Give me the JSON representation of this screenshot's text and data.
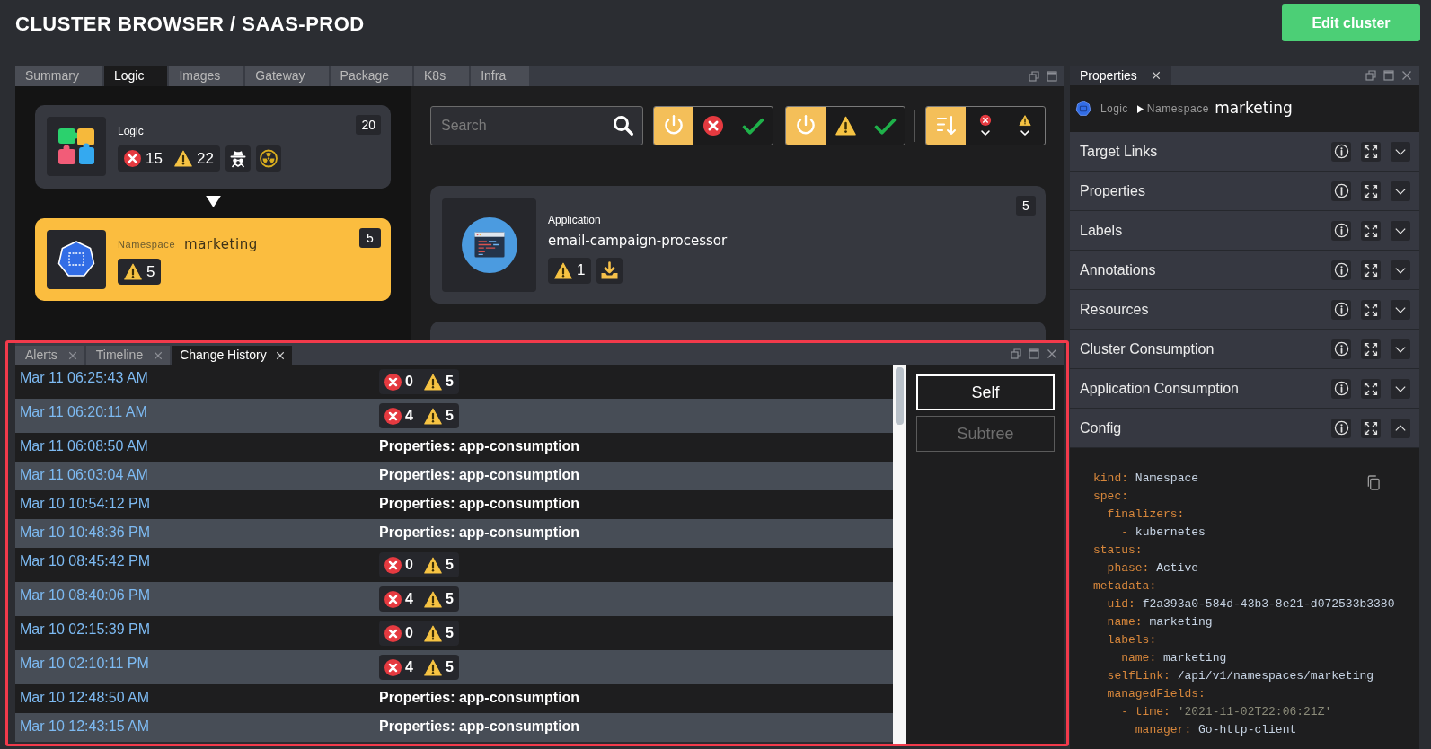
{
  "header": {
    "title": "CLUSTER BROWSER / SAAS-PROD",
    "button": "Edit cluster"
  },
  "main_panel": {
    "tabs": [
      {
        "label": "Summary",
        "selected": false
      },
      {
        "label": "Logic",
        "selected": true
      },
      {
        "label": "Images",
        "selected": false
      },
      {
        "label": "Gateway",
        "selected": false
      },
      {
        "label": "Package",
        "selected": false
      },
      {
        "label": "K8s",
        "selected": false
      },
      {
        "label": "Infra",
        "selected": false
      }
    ],
    "graph": [
      {
        "kind": "logic",
        "label": "Logic",
        "count": "20",
        "errors": "15",
        "warnings": "22",
        "flags": [
          {
            "kind": "spy"
          },
          {
            "kind": "radiation"
          }
        ],
        "selected": false
      },
      {
        "kind": "namespace",
        "label": "Namespace",
        "name": "marketing",
        "count": "5",
        "warnings": "5",
        "selected": true
      }
    ],
    "search": {
      "placeholder": "Search"
    },
    "filter_groups": [
      {
        "buttons": [
          {
            "kind": "power",
            "on": true
          },
          {
            "kind": "errors",
            "on": false
          },
          {
            "kind": "ok",
            "on": false
          }
        ]
      },
      {
        "buttons": [
          {
            "kind": "power",
            "on": true
          },
          {
            "kind": "warnings",
            "on": false
          },
          {
            "kind": "ok",
            "on": false
          }
        ]
      },
      {
        "buttons": [
          {
            "kind": "sort",
            "on": true
          },
          {
            "kind": "errors_sort",
            "on": false
          },
          {
            "kind": "warnings_sort",
            "on": false
          }
        ]
      }
    ],
    "items": [
      {
        "kind": "application",
        "label": "Application",
        "name": "email-campaign-processor",
        "count": "5",
        "warnings": "1",
        "flags": [
          {
            "kind": "download"
          }
        ]
      }
    ]
  },
  "bottom_panel": {
    "tabs": [
      {
        "label": "Alerts",
        "selected": false
      },
      {
        "label": "Timeline",
        "selected": false
      },
      {
        "label": "Change History",
        "selected": true
      }
    ],
    "rows": [
      {
        "time": "Mar 11 06:25:43 AM",
        "kind": "counts",
        "errors": "0",
        "warnings": "5"
      },
      {
        "time": "Mar 11 06:20:11 AM",
        "kind": "counts",
        "errors": "4",
        "warnings": "5"
      },
      {
        "time": "Mar 11 06:08:50 AM",
        "kind": "change",
        "text": "Properties: app-consumption"
      },
      {
        "time": "Mar 11 06:03:04 AM",
        "kind": "change",
        "text": "Properties: app-consumption"
      },
      {
        "time": "Mar 10 10:54:12 PM",
        "kind": "change",
        "text": "Properties: app-consumption"
      },
      {
        "time": "Mar 10 10:48:36 PM",
        "kind": "change",
        "text": "Properties: app-consumption"
      },
      {
        "time": "Mar 10 08:45:42 PM",
        "kind": "counts",
        "errors": "0",
        "warnings": "5"
      },
      {
        "time": "Mar 10 08:40:06 PM",
        "kind": "counts",
        "errors": "4",
        "warnings": "5"
      },
      {
        "time": "Mar 10 02:15:39 PM",
        "kind": "counts",
        "errors": "0",
        "warnings": "5"
      },
      {
        "time": "Mar 10 02:10:11 PM",
        "kind": "counts",
        "errors": "4",
        "warnings": "5"
      },
      {
        "time": "Mar 10 12:48:50 AM",
        "kind": "change",
        "text": "Properties: app-consumption"
      },
      {
        "time": "Mar 10 12:43:15 AM",
        "kind": "change",
        "text": "Properties: app-consumption"
      }
    ],
    "scope_buttons": [
      {
        "label": "Self",
        "selected": true
      },
      {
        "label": "Subtree",
        "selected": false
      }
    ]
  },
  "properties_panel": {
    "tab": "Properties",
    "breadcrumb": {
      "parent": "Logic",
      "type": "Namespace",
      "name": "marketing"
    },
    "sections": [
      {
        "title": "Target Links",
        "expanded": false
      },
      {
        "title": "Properties",
        "expanded": false
      },
      {
        "title": "Labels",
        "expanded": false
      },
      {
        "title": "Annotations",
        "expanded": false
      },
      {
        "title": "Resources",
        "expanded": false
      },
      {
        "title": "Cluster Consumption",
        "expanded": false
      },
      {
        "title": "Application Consumption",
        "expanded": false
      },
      {
        "title": "Config",
        "expanded": true,
        "content": [
          {
            "key": "kind:",
            "value": "Namespace"
          },
          {
            "key": "spec:",
            "children": [
              {
                "key": "finalizers:",
                "children": [
                  {
                    "key": "-",
                    "value": "kubernetes"
                  }
                ]
              }
            ]
          },
          {
            "key": "status:",
            "children": [
              {
                "key": "phase:",
                "value": "Active"
              }
            ]
          },
          {
            "key": "metadata:",
            "children": [
              {
                "key": "uid:",
                "value": "f2a393a0-584d-43b3-8e21-d072533b3380"
              },
              {
                "key": "name:",
                "value": "marketing"
              },
              {
                "key": "labels:",
                "children": [
                  {
                    "key": "name:",
                    "value": "marketing"
                  }
                ]
              },
              {
                "key": "selfLink:",
                "value": "/api/v1/namespaces/marketing"
              },
              {
                "key": "managedFields:",
                "children": [
                  {
                    "key": "- time:",
                    "string": "'2021-11-02T22:06:21Z'",
                    "children": [
                      {
                        "key": "manager:",
                        "value": "Go-http-client"
                      }
                    ]
                  }
                ]
              }
            ]
          }
        ]
      }
    ]
  }
}
